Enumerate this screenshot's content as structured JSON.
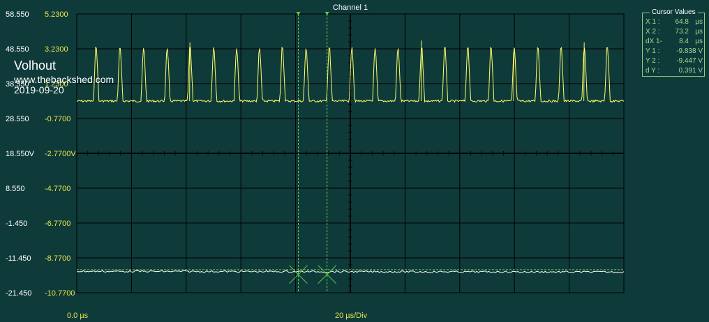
{
  "title": "Channel 1",
  "watermark": {
    "name": "Volhout",
    "site": "www.thebackshed.com",
    "date": "2019-09-20"
  },
  "y_labels_left": [
    "58.550",
    "48.550",
    "38.550",
    "28.550",
    "18.550V",
    "8.550",
    "-1.450",
    "-11.450",
    "-21.450"
  ],
  "y_labels_right": [
    "5.2300",
    "3.2300",
    "1.2300",
    "-0.7700",
    "-2.7700V",
    "-4.7700",
    "-6.7700",
    "-8.7700",
    "-10.7700"
  ],
  "x_start_label": "0.0 µs",
  "x_scale_label": "20 µs/Div",
  "cursor_panel": {
    "title": "Cursor Values",
    "rows": [
      {
        "label": "X 1 :",
        "value": "64.8",
        "unit": "µs"
      },
      {
        "label": "X 2 :",
        "value": "73.2",
        "unit": "µs"
      },
      {
        "label": "dX 1-",
        "value": "8.4",
        "unit": "µs"
      },
      {
        "label": "Y 1 :",
        "value": "-9.838 V",
        "unit": ""
      },
      {
        "label": "Y 2 :",
        "value": "-9.447 V",
        "unit": ""
      },
      {
        "label": "d Y :",
        "value": "0.391 V",
        "unit": ""
      }
    ]
  },
  "colors": {
    "background": "#0f3a3a",
    "grid": "#000000",
    "trace_a": "#ffff66",
    "trace_b": "#ffffff",
    "cursor": "#66cc44"
  },
  "chart_data": {
    "type": "line",
    "title": "Channel 1",
    "xlabel": "",
    "ylabel": "",
    "xlim": [
      0,
      160
    ],
    "x_units": "µs",
    "ylim_left": [
      -21.45,
      58.55
    ],
    "ylim_right": [
      -10.77,
      5.23
    ],
    "grid": true,
    "series": [
      {
        "name": "",
        "baseline": 0.23,
        "pulse_peak": 3.23,
        "pulse_times_us": [
          5.5,
          12.5,
          19.4,
          26.3,
          33.0,
          39.9,
          46.6,
          53.3,
          60.0,
          66.9,
          73.7,
          80.3,
          87.1,
          93.8,
          100.7,
          107.5,
          114.2,
          121.0,
          127.8,
          134.7,
          141.5,
          148.3,
          155.0
        ]
      },
      {
        "name": "",
        "values_start_end": [
          -9.54,
          -9.58
        ],
        "level": -9.56
      }
    ],
    "cursors": {
      "x1_us": 64.8,
      "x2_us": 73.2,
      "y1_v": -9.838,
      "y2_v": -9.447
    }
  }
}
